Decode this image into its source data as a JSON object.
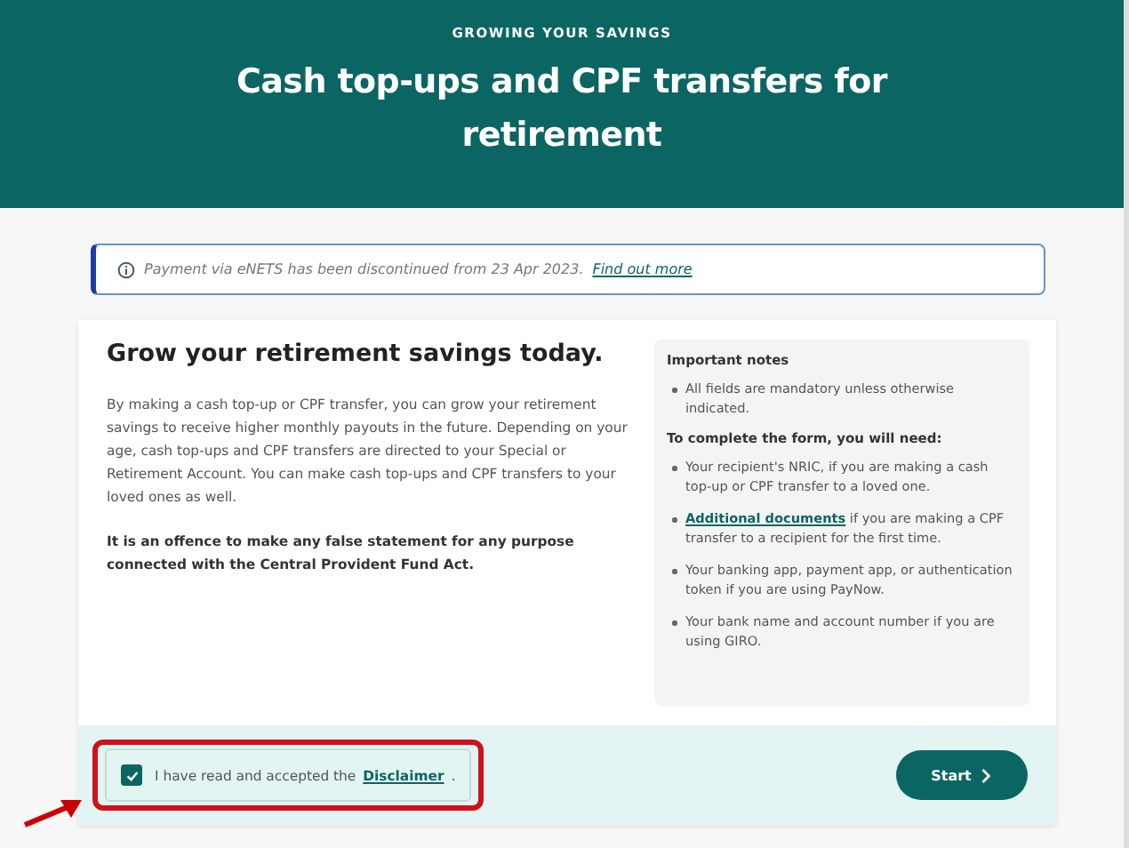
{
  "header": {
    "eyebrow": "GROWING YOUR SAVINGS",
    "title": "Cash top-ups and CPF transfers for retirement"
  },
  "alert": {
    "text": "Payment via eNETS has been discontinued from 23 Apr 2023.",
    "link": "Find out more"
  },
  "intro": {
    "heading": "Grow your retirement savings today.",
    "body": "By making a cash top-up or CPF transfer, you can grow your retirement savings to receive higher monthly payouts in the future. Depending on your age, cash top-ups and CPF transfers are directed to your Special or Retirement Account. You can make cash top-ups and CPF transfers to your loved ones as well.",
    "warning": "It is an offence to make any false statement for any purpose connected with the Central Provident Fund Act."
  },
  "notes": {
    "sections": [
      {
        "heading": "Important notes",
        "items": [
          {
            "text": "All fields are mandatory unless otherwise indicated."
          }
        ]
      },
      {
        "heading": "To complete the form, you will need:",
        "items": [
          {
            "text": "Your recipient's NRIC, if you are making a cash top-up or CPF transfer to a loved one."
          },
          {
            "link": "Additional documents",
            "text": " if you are making a CPF transfer to a recipient for the first time."
          },
          {
            "text": "Your banking app, payment app, or authentication token if you are using PayNow."
          },
          {
            "text": "Your bank name and account number if you are using GIRO."
          }
        ]
      }
    ]
  },
  "consent": {
    "checked": true,
    "text": "I have read and accepted the",
    "link": "Disclaimer",
    "after": "."
  },
  "start_button": {
    "label": "Start"
  },
  "annotation": {
    "highlight": true
  }
}
